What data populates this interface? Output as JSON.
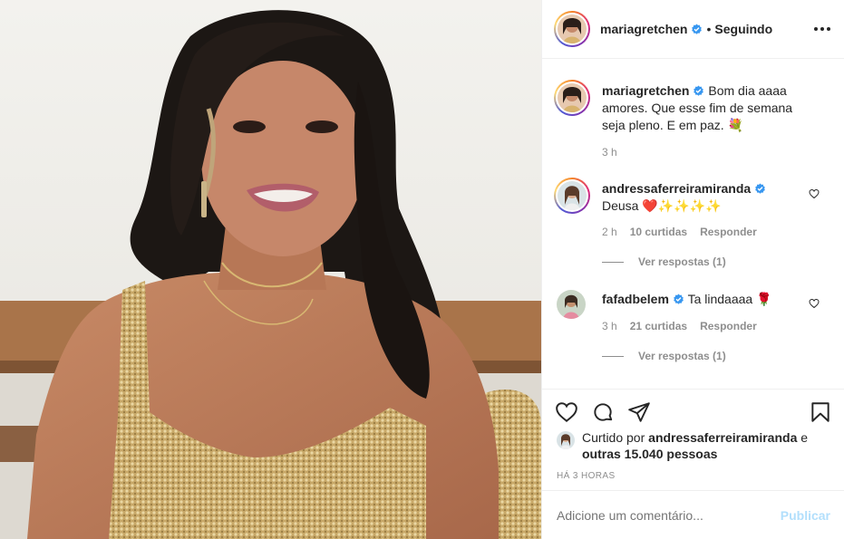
{
  "post": {
    "username": "mariagretchen",
    "separator": "•",
    "follow_status": "Seguindo"
  },
  "caption": {
    "username": "mariagretchen",
    "text": "Bom dia aaaa amores. Que esse fim de semana seja pleno. E em paz. 💐",
    "time": "3 h"
  },
  "comments": [
    {
      "username": "andressaferreiramiranda",
      "text": "Deusa ❤️✨✨✨✨",
      "time": "2 h",
      "likes": "10 curtidas",
      "reply": "Responder",
      "view_replies": "Ver respostas (1)"
    },
    {
      "username": "fafadbelem",
      "text": "Ta lindaaaa 🌹",
      "time": "3 h",
      "likes": "21 curtidas",
      "reply": "Responder",
      "view_replies": "Ver respostas (1)"
    }
  ],
  "likes_line": {
    "prefix": "Curtido por",
    "user": "andressaferreiramiranda",
    "and": "e",
    "others": "outras 15.040 pessoas"
  },
  "posted_ago": "HÁ 3 HORAS",
  "add_comment": {
    "placeholder": "Adicione um comentário...",
    "publish": "Publicar"
  },
  "icons": {
    "verified": "verified-badge-icon",
    "more": "more-options-icon",
    "like": "heart-icon",
    "comment": "comment-bubble-icon",
    "share": "paper-plane-icon",
    "save": "bookmark-icon"
  },
  "colors": {
    "verified": "#3897f0",
    "publish_disabled": "#b2dffc",
    "muted": "#8e8e8e",
    "text": "#262626"
  }
}
